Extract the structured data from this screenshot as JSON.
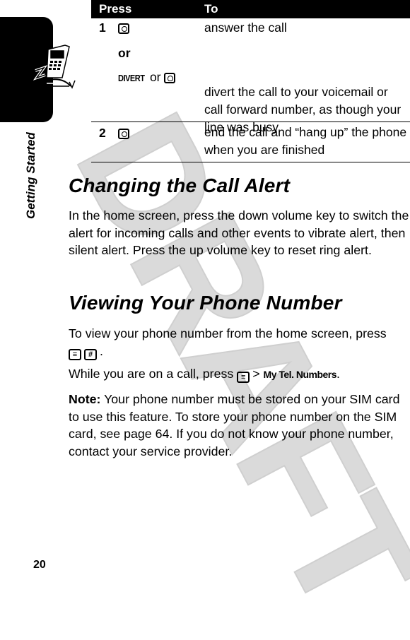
{
  "page": {
    "number": "20",
    "section_tab": "Getting Started",
    "watermark": "DRAFT"
  },
  "table": {
    "headers": {
      "press": "Press",
      "to": "To"
    },
    "rows": [
      {
        "num": "1",
        "entries": [
          {
            "press_key": "send-key",
            "to": "answer the call"
          },
          {
            "connector": "or"
          },
          {
            "press_label": "DIVERT",
            "press_or": "or",
            "press_key": "end-key",
            "to": "divert the call to your voicemail or call forward number, as though your line was busy"
          }
        ]
      },
      {
        "num": "2",
        "entries": [
          {
            "press_key": "end-key",
            "to": "end the call and “hang up” the phone when you are finished"
          }
        ]
      }
    ]
  },
  "sections": [
    {
      "title": "Changing the Call Alert",
      "body": "In the home screen, press the down volume key to switch the alert for incoming calls and other events to vibrate alert, then silent alert. Press the up volume key to reset ring alert."
    },
    {
      "title": "Viewing Your Phone Number",
      "para1": "To view your phone number from the home screen, press",
      "para1_keys": [
        "≡",
        "#"
      ],
      "para1_end": ".",
      "para2_start": "While you are on a call, press",
      "para2_key": "≡",
      "para2_sep": ">",
      "para2_menu": "My Tel. Numbers",
      "para2_end": ".",
      "note_label": "Note:",
      "note_body": "Your phone number must be stored on your SIM card to use this feature. To store your phone number on the SIM card, see page 64. If you do not know your phone number, contact your service provider."
    }
  ]
}
